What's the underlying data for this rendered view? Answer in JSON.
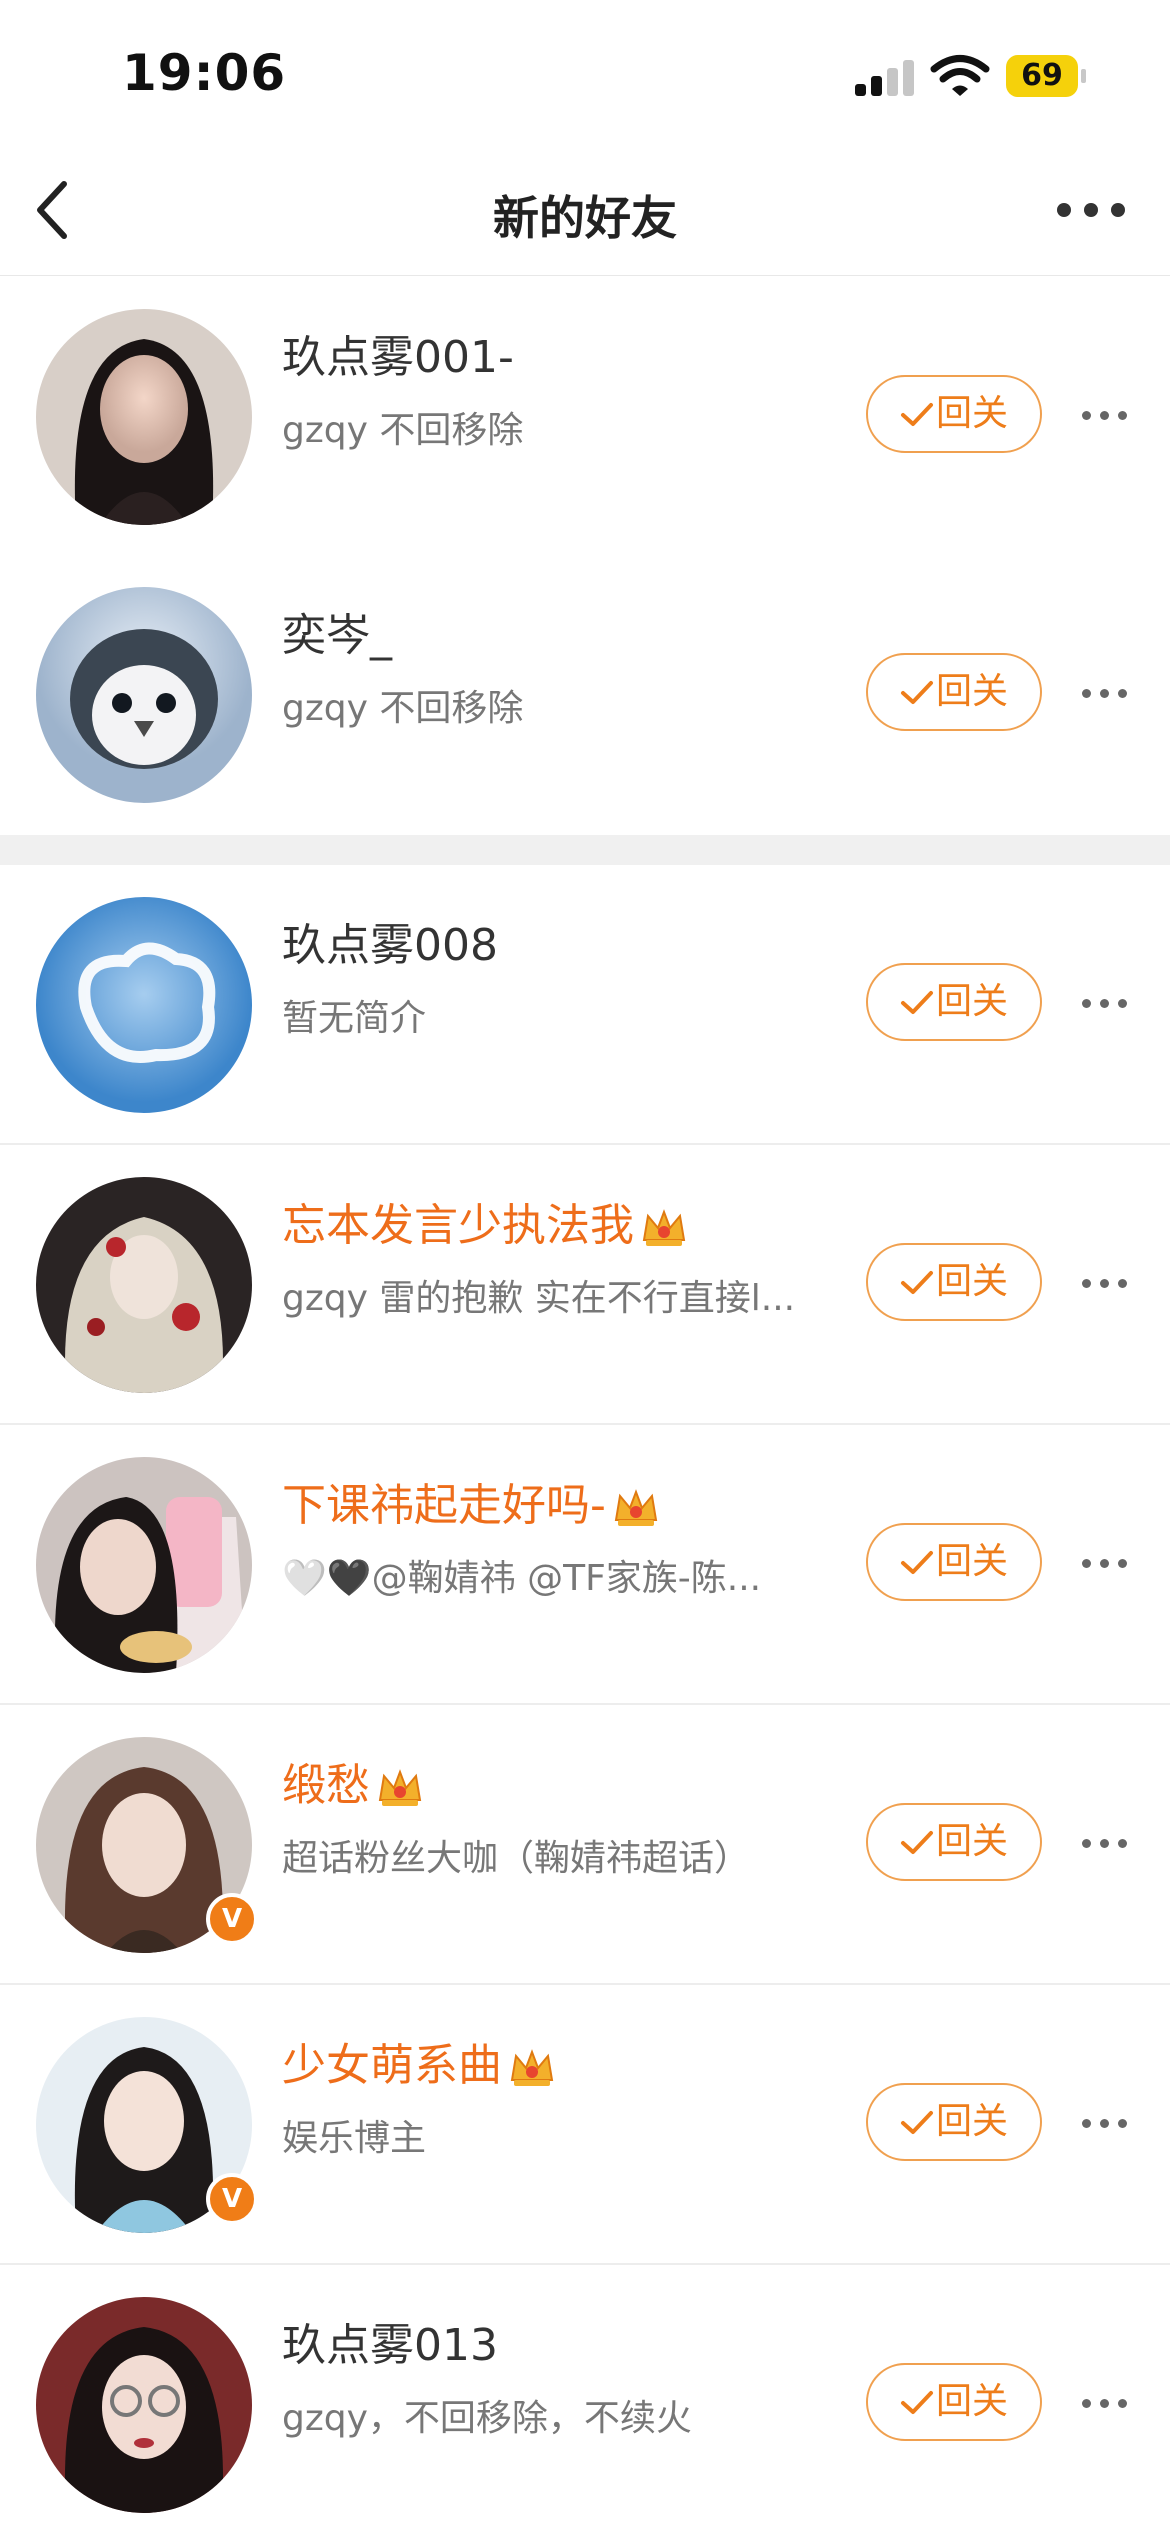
{
  "status": {
    "time": "19:06",
    "battery": "69"
  },
  "nav": {
    "title": "新的好友"
  },
  "button": {
    "follow_back": "回关"
  },
  "rows": [
    {
      "name": "玖点雾001-",
      "desc": "gzqy 不回移除",
      "vip": false,
      "verified": false
    },
    {
      "name": "奕岑_",
      "desc": "gzqy 不回移除",
      "vip": false,
      "verified": false
    },
    {
      "name": "玖点雾008",
      "desc": "暂无简介",
      "vip": false,
      "verified": false
    },
    {
      "name": "忘本发言少执法我",
      "desc": "gzqy 雷的抱歉 实在不行直接l...",
      "vip": true,
      "verified": false
    },
    {
      "name": "下课祎起走好吗-",
      "desc": "🤍🖤@鞠婧祎 @TF家族-陈...",
      "vip": true,
      "verified": false
    },
    {
      "name": "缎愁",
      "desc": "超话粉丝大咖（鞠婧祎超话）",
      "vip": true,
      "verified": true
    },
    {
      "name": "少女萌系曲",
      "desc": "娱乐博主",
      "vip": true,
      "verified": true
    },
    {
      "name": "玖点雾013",
      "desc": "gzqy，不回移除，不续火",
      "vip": false,
      "verified": false
    }
  ],
  "colors": {
    "accent": "#ee7d1a",
    "vip_name": "#ee6d1a",
    "divider": "#ededed",
    "section_gap": "#f0f0f0"
  },
  "icons": [
    "back-chevron-icon",
    "more-icon",
    "check-icon",
    "vip-crown-icon",
    "verified-v-icon"
  ]
}
